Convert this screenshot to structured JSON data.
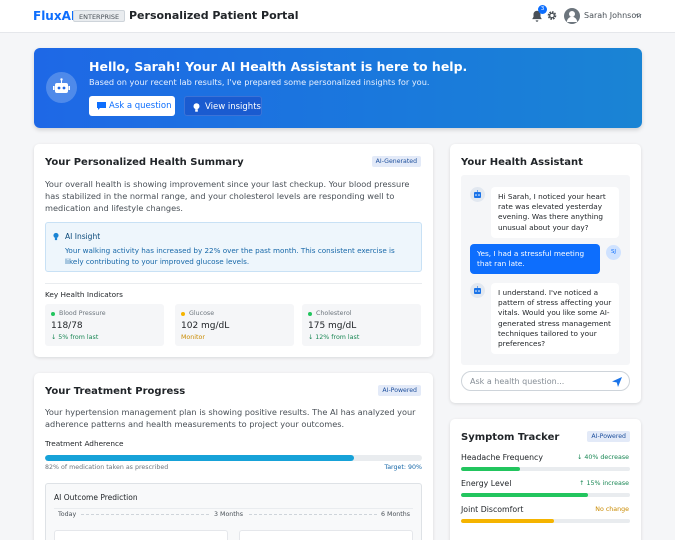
{
  "header": {
    "logo": "FluxAI",
    "edition": "ENTERPRISE",
    "title": "Personalized Patient Portal",
    "notif_count": "3",
    "user_name": "Sarah Johnson"
  },
  "hero": {
    "title": "Hello, Sarah! Your AI Health Assistant is here to help.",
    "subtitle": "Based on your recent lab results, I've prepared some personalized insights for you.",
    "ask_label": "Ask a question",
    "insights_label": "View insights"
  },
  "summary": {
    "title": "Your Personalized Health Summary",
    "badge": "AI-Generated",
    "text": "Your overall health is showing improvement since your last checkup. Your blood pressure has stabilized in the normal range, and your cholesterol levels are responding well to medication and lifestyle changes.",
    "insight_title": "AI Insight",
    "insight_text": "Your walking activity has increased by 22% over the past month. This consistent exercise is likely contributing to your improved glucose levels.",
    "indicators_title": "Key Health Indicators",
    "indicators": [
      {
        "label": "Blood Pressure",
        "value": "118/78",
        "sub": "↓ 5% from last",
        "dot": "#22c55e",
        "sub_color": "#198754"
      },
      {
        "label": "Glucose",
        "value": "102 mg/dL",
        "sub": "Monitor",
        "dot": "#f5b400",
        "sub_color": "#c98a00"
      },
      {
        "label": "Cholesterol",
        "value": "175 mg/dL",
        "sub": "↓ 12% from last",
        "dot": "#22c55e",
        "sub_color": "#198754"
      }
    ]
  },
  "treatment": {
    "title": "Your Treatment Progress",
    "badge": "AI-Powered",
    "text": "Your hypertension management plan is showing positive results. The AI has analyzed your adherence patterns and health measurements to project your outcomes.",
    "adherence_label": "Treatment Adherence",
    "adherence": 0.82,
    "adherence_note": "82% of medication taken as prescribed",
    "target": "Target: 90%",
    "prediction_title": "AI Outcome Prediction",
    "timeline": [
      "Today",
      "3 Months",
      "6 Months"
    ]
  },
  "assistant": {
    "title": "Your Health Assistant",
    "messages": [
      {
        "from": "bot",
        "text": "Hi Sarah, I noticed your heart rate was elevated yesterday evening. Was there anything unusual about your day?"
      },
      {
        "from": "user",
        "text": "Yes, I had a stressful meeting that ran late.",
        "initials": "SJ"
      },
      {
        "from": "bot",
        "text": "I understand. I've noticed a pattern of stress affecting your vitals. Would you like some AI-generated stress management techniques tailored to your preferences?"
      }
    ],
    "placeholder": "Ask a health question..."
  },
  "symptoms": {
    "title": "Symptom Tracker",
    "badge": "AI-Powered",
    "items": [
      {
        "label": "Headache Frequency",
        "change": "↓ 40% decrease",
        "level": 0.35,
        "color": "#22c55e",
        "change_color": "#198754"
      },
      {
        "label": "Energy Level",
        "change": "↑ 15% increase",
        "level": 0.75,
        "color": "#22c55e",
        "change_color": "#198754"
      },
      {
        "label": "Joint Discomfort",
        "change": "No change",
        "level": 0.55,
        "color": "#f5b400",
        "change_color": "#c98a00"
      }
    ]
  }
}
